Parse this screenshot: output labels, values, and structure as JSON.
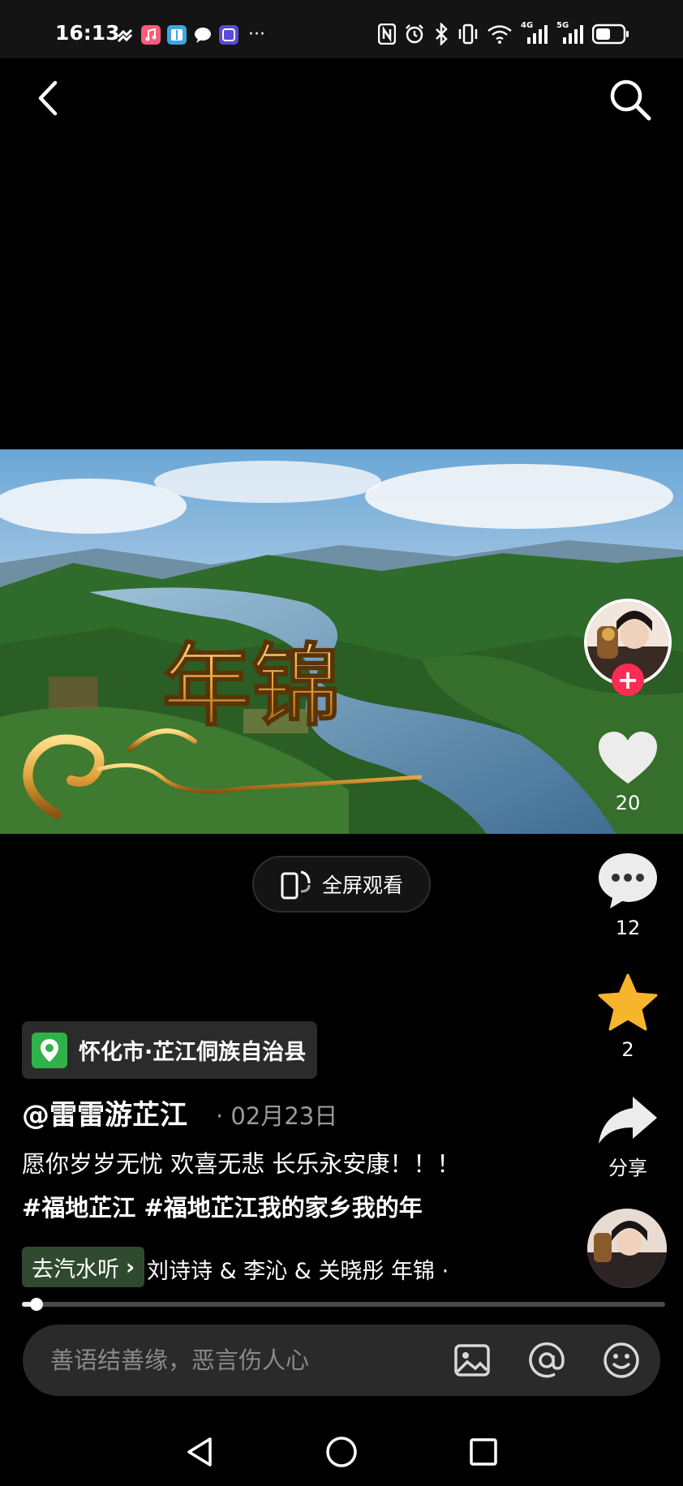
{
  "status_bar": {
    "time": "16:13",
    "more": "···",
    "network_1": "4G",
    "network_2": "5G"
  },
  "icons": {
    "back": "chevron-left-icon",
    "search": "search-icon",
    "like": "heart-icon",
    "comment": "comment-bubble-icon",
    "favorite": "star-icon",
    "share": "share-arrow-icon"
  },
  "video": {
    "overlay_title": "年锦",
    "fullscreen_label": "全屏观看"
  },
  "rail": {
    "follow_symbol": "+",
    "likes": "20",
    "comments": "12",
    "favorites": "2",
    "share_label": "分享"
  },
  "post": {
    "location": "怀化市·芷江侗族自治县",
    "author": "@雷雷游芷江",
    "date": "· 02月23日",
    "caption": "愿你岁岁无忧 欢喜无悲 长乐永安康！！！",
    "hashtags": "#福地芷江 #福地芷江我的家乡我的年"
  },
  "music": {
    "chip_label": "去汽水听",
    "chip_arrow": "›",
    "title": "刘诗诗 & 李沁 & 关晓彤    年锦  ·"
  },
  "progress": {
    "fraction": 0.015
  },
  "comment_bar": {
    "placeholder": "善语结善缘，恶言伤人心"
  },
  "colors": {
    "background": "#000000",
    "follow": "#fe2c55",
    "favorite": "#f7b52c",
    "location_pin": "#2fb24a"
  }
}
